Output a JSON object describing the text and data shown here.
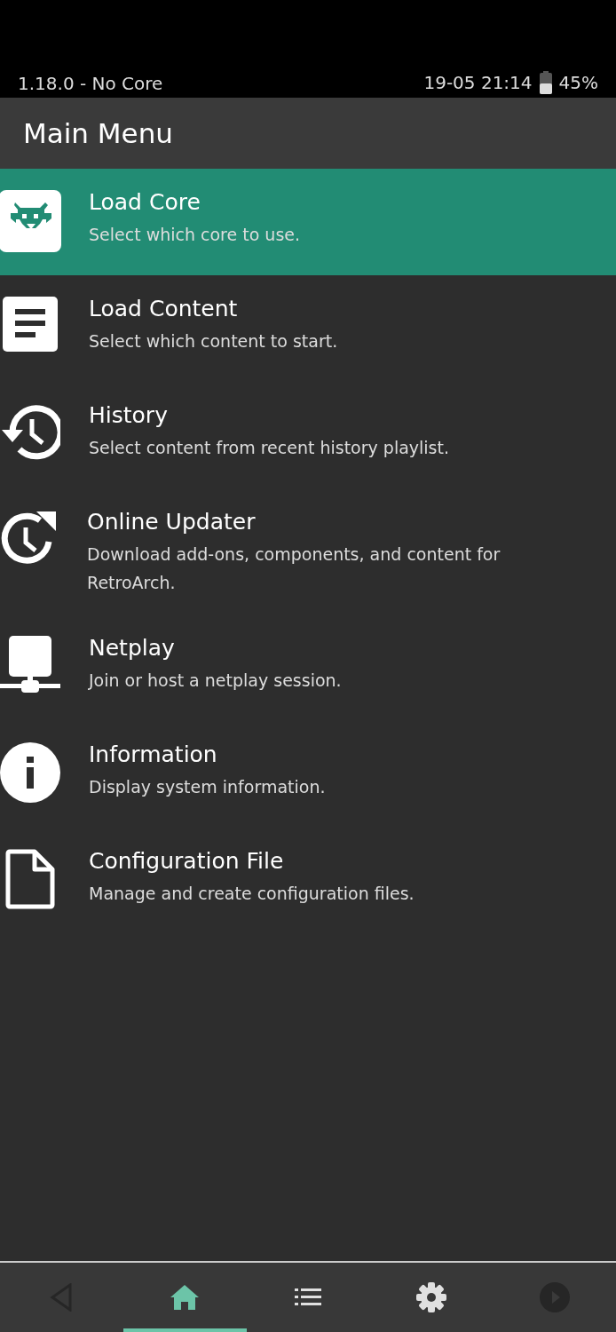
{
  "status_bar": {
    "left": "1.18.0 - No Core",
    "time": "19-05 21:14",
    "battery": "45%"
  },
  "header": {
    "title": "Main Menu"
  },
  "menu": [
    {
      "kind": "core",
      "title": "Load Core",
      "subtitle": "Select which core to use.",
      "selected": true
    },
    {
      "kind": "content",
      "title": "Load Content",
      "subtitle": "Select which content to start.",
      "selected": false
    },
    {
      "kind": "history",
      "title": "History",
      "subtitle": "Select content from recent history playlist.",
      "selected": false
    },
    {
      "kind": "updater",
      "title": "Online Updater",
      "subtitle": "Download add-ons, components, and content for RetroArch.",
      "selected": false
    },
    {
      "kind": "netplay",
      "title": "Netplay",
      "subtitle": "Join or host a netplay session.",
      "selected": false
    },
    {
      "kind": "info",
      "title": "Information",
      "subtitle": "Display system information.",
      "selected": false
    },
    {
      "kind": "file",
      "title": "Configuration File",
      "subtitle": "Manage and create configuration files.",
      "selected": false
    }
  ],
  "tabs": [
    {
      "kind": "back",
      "selected": false,
      "disabled": true
    },
    {
      "kind": "home",
      "selected": true,
      "disabled": false
    },
    {
      "kind": "list",
      "selected": false,
      "disabled": false
    },
    {
      "kind": "settings",
      "selected": false,
      "disabled": false
    },
    {
      "kind": "play",
      "selected": false,
      "disabled": true
    }
  ]
}
